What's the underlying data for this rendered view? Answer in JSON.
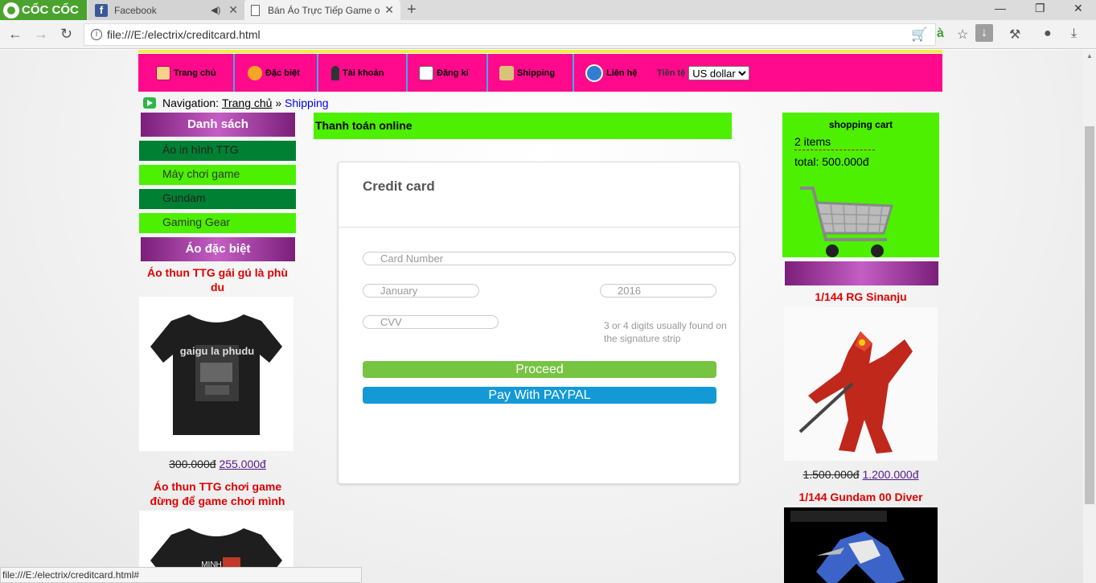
{
  "browser": {
    "brand": "CỐC CỐC",
    "tabs": [
      {
        "title": "Facebook"
      },
      {
        "title": "Bán Áo Trực Tiếp Game o"
      }
    ],
    "address": "file:///E:/electrix/creditcard.html",
    "status_url": "file:///E:/electrix/creditcard.html#"
  },
  "nav": {
    "items": [
      {
        "label": "Trang chủ",
        "icon": "home-icon"
      },
      {
        "label": "Đặc biệt",
        "icon": "hand-icon"
      },
      {
        "label": "Tài khoản",
        "icon": "user-icon"
      },
      {
        "label": "Đăng kí",
        "icon": "register-icon"
      },
      {
        "label": "Shipping",
        "icon": "shipping-icon"
      },
      {
        "label": "Liên hệ",
        "icon": "phone-icon"
      }
    ],
    "currency_label": "Tiền tệ",
    "currency_value": "US dollar"
  },
  "breadcrumb": {
    "prefix": "Navigation:",
    "home": "Trang chủ",
    "sep": "»",
    "current": "Shipping"
  },
  "left": {
    "list_heading": "Danh sách",
    "categories": [
      "Áo in hình TTG",
      "Máy chơi game",
      "Gundam",
      "Gaming Gear"
    ],
    "special_heading": "Áo đặc biệt",
    "products": [
      {
        "name": "Áo thun TTG gái gú là phù du",
        "old_price": "300.000đ",
        "new_price": "255.000đ",
        "print": "gaigu la phudu"
      },
      {
        "name": "Áo thun TTG chơi game đừng để game chơi mình",
        "print": "MINH"
      }
    ]
  },
  "center": {
    "heading": "Thanh toán online",
    "card_title": "Credit card",
    "card_number_placeholder": "Card Number",
    "month": "January",
    "year": "2016",
    "cvv_placeholder": "CVV",
    "cvv_hint": "3 or 4 digits usually found on the signature strip",
    "proceed": "Proceed",
    "paypal": "Pay With PAYPAL"
  },
  "right": {
    "cart_title": "shopping cart",
    "cart_items": "2 items",
    "cart_total": "total: 500.000đ",
    "products": [
      {
        "name": "1/144 RG Sinanju",
        "old_price": "1.500.000đ",
        "new_price": "1.200.000đ"
      },
      {
        "name": "1/144 Gundam 00 Diver"
      }
    ]
  },
  "colors": {
    "nav_bg": "#ff0a8c",
    "green_bright": "#4cf000",
    "green_dark": "#008032",
    "proceed_btn": "#76c442",
    "paypal_btn": "#139ad6",
    "product_title": "#e00000"
  }
}
